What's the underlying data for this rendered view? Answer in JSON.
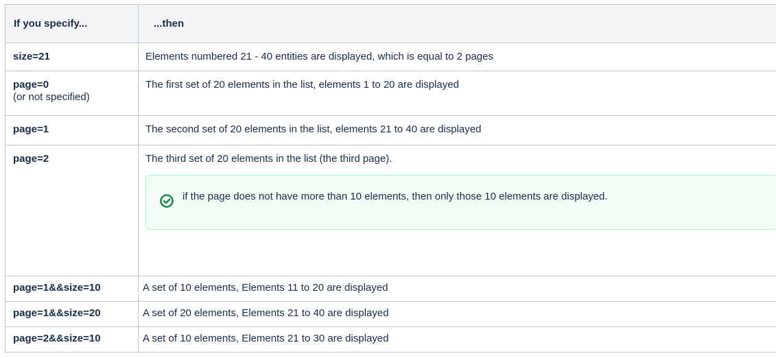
{
  "table": {
    "header": {
      "col1": "If you specify...",
      "col2": "...then"
    },
    "rows": [
      {
        "param": "size=21",
        "note": "",
        "result": "Elements numbered 21 - 40 entities are displayed, which is equal to 2 pages"
      },
      {
        "param": "page=0",
        "note": "(or not specified)",
        "result": "The first set of 20 elements in the list, elements 1 to 20 are displayed"
      },
      {
        "param": "page=1",
        "note": "",
        "result": "The second set of 20 elements in the list, elements 21 to 40 are displayed"
      },
      {
        "param": "page=2",
        "note": "",
        "result": "The third set of 20 elements in the list (the third page).",
        "panel": {
          "icon": "check-circle-icon",
          "message": "if the page does not have more than 10 elements, then only those 10 elements are displayed.",
          "border_color": "#abf5d1",
          "background_color": "#f3fcf5",
          "icon_color": "#1f8a4c"
        }
      },
      {
        "param": "page=1&&size=10",
        "note": "",
        "result": "A set of 10 elements, Elements 11 to 20 are displayed"
      },
      {
        "param": "page=1&&size=20",
        "note": "",
        "result": "A set of 20 elements, Elements 21 to 40 are displayed"
      },
      {
        "param": "page=2&&size=10",
        "note": "",
        "result": "A set of 10 elements, Elements 21 to 30 are displayed"
      }
    ]
  }
}
